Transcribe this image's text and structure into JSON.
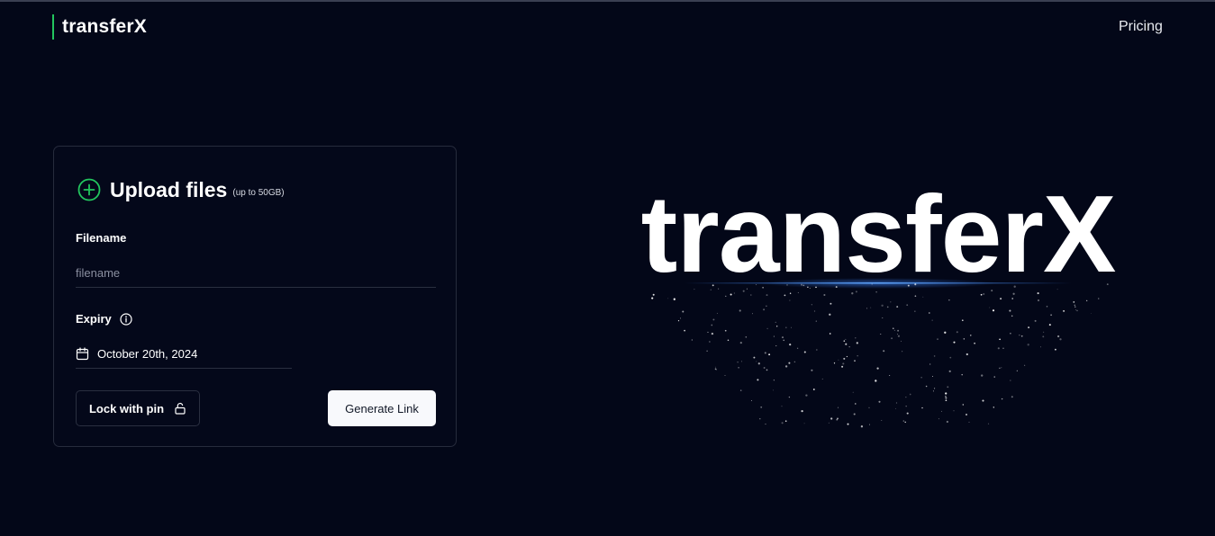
{
  "brand": {
    "name": "transferX",
    "accent": "#22c55e"
  },
  "nav": {
    "pricing": "Pricing"
  },
  "upload": {
    "title": "Upload files",
    "note": "(up to 50GB)",
    "filename_label": "Filename",
    "filename_placeholder": "filename",
    "filename_value": "",
    "expiry_label": "Expiry",
    "expiry_date": "October 20th, 2024",
    "lock_label": "Lock with pin",
    "generate_label": "Generate Link"
  },
  "hero": {
    "title": "transferX"
  },
  "icons": {
    "upload": "plus-circle-icon",
    "info": "info-icon",
    "calendar": "calendar-icon",
    "lock": "lock-open-icon"
  },
  "colors": {
    "background": "#030718",
    "accent_green": "#22c55e",
    "glow_blue": "#3b82f6",
    "button_bg": "#f8f9fc"
  }
}
